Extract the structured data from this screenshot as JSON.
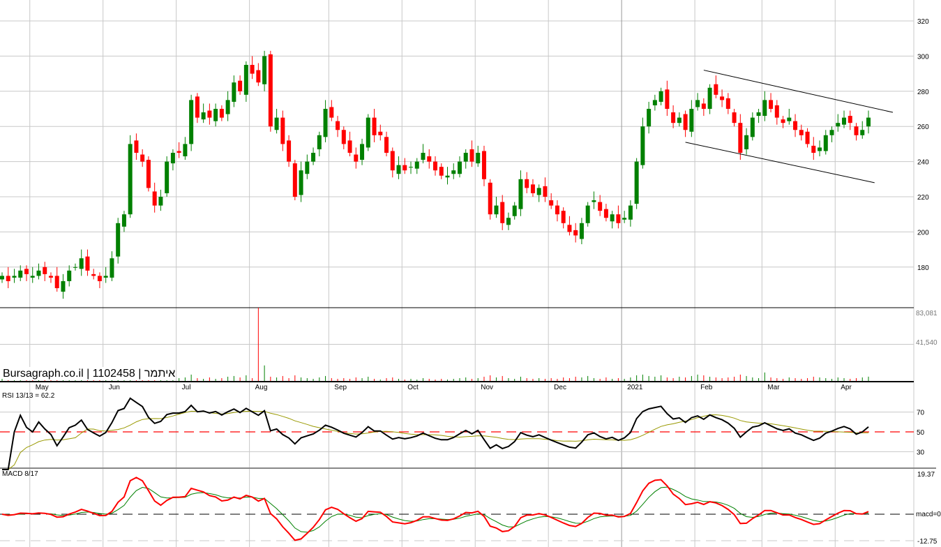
{
  "watermark": "Bursagraph.co.il | 1102458 | איתמר",
  "rsi_label": "RSI 13/13 = 62.2",
  "macd_label": "MACD 8/17",
  "chart_data": {
    "type": "candlestick",
    "price_axis": {
      "ticks": [
        180,
        200,
        220,
        240,
        260,
        280,
        300,
        320
      ],
      "range": [
        164,
        332
      ]
    },
    "volume_axis": {
      "ticks": [
        "83,081",
        "41,540"
      ],
      "max": 83081
    },
    "rsi_axis": {
      "ticks": [
        70,
        50,
        30
      ],
      "ref": 50
    },
    "macd_axis": {
      "ticks": [
        "19.37",
        "macd=0",
        "-12.75"
      ],
      "max": 19.37,
      "min": -12.75
    },
    "months": [
      {
        "label": "May",
        "i": 5
      },
      {
        "label": "Jun",
        "i": 17
      },
      {
        "label": "Jul",
        "i": 29
      },
      {
        "label": "Aug",
        "i": 41
      },
      {
        "label": "Sep",
        "i": 54
      },
      {
        "label": "Oct",
        "i": 66
      },
      {
        "label": "Nov",
        "i": 78
      },
      {
        "label": "Dec",
        "i": 90
      },
      {
        "label": "2021",
        "i": 102
      },
      {
        "label": "Feb",
        "i": 114
      },
      {
        "label": "Mar",
        "i": 125
      },
      {
        "label": "Apr",
        "i": 137
      }
    ],
    "closes": [
      175,
      172,
      175,
      178,
      176,
      175,
      178,
      176,
      174,
      168,
      172,
      178,
      180,
      185,
      178,
      175,
      172,
      175,
      185,
      205,
      210,
      250,
      245,
      240,
      225,
      215,
      220,
      240,
      245,
      245,
      250,
      275,
      265,
      268,
      265,
      270,
      265,
      275,
      285,
      280,
      295,
      290,
      285,
      300,
      260,
      265,
      250,
      240,
      220,
      235,
      240,
      245,
      255,
      270,
      265,
      258,
      250,
      245,
      240,
      250,
      265,
      255,
      255,
      245,
      235,
      238,
      235,
      237,
      240,
      245,
      240,
      235,
      232,
      232,
      235,
      240,
      245,
      240,
      245,
      230,
      210,
      215,
      205,
      208,
      215,
      230,
      225,
      222,
      225,
      220,
      215,
      210,
      205,
      200,
      198,
      205,
      215,
      218,
      212,
      208,
      210,
      205,
      208,
      215,
      240,
      260,
      270,
      275,
      280,
      270,
      262,
      265,
      258,
      270,
      275,
      270,
      282,
      278,
      275,
      270,
      262,
      245,
      255,
      265,
      268,
      275,
      270,
      265,
      262,
      265,
      258,
      255,
      250,
      245,
      248,
      255,
      258,
      262,
      265,
      262,
      255,
      258,
      265
    ],
    "volumes": [
      3,
      2,
      4,
      3,
      2,
      3,
      2,
      4,
      3,
      5,
      2,
      3,
      4,
      5,
      3,
      2,
      3,
      4,
      6,
      9,
      8,
      12,
      7,
      6,
      5,
      4,
      3,
      6,
      5,
      4,
      5,
      9,
      4,
      3,
      5,
      3,
      4,
      6,
      7,
      5,
      8,
      4,
      83081,
      22,
      6,
      5,
      7,
      4,
      8,
      5,
      4,
      3,
      5,
      7,
      4,
      3,
      4,
      3,
      5,
      4,
      6,
      3,
      2,
      4,
      5,
      3,
      2,
      3,
      2,
      4,
      3,
      2,
      3,
      2,
      3,
      4,
      5,
      3,
      4,
      6,
      8,
      5,
      7,
      4,
      3,
      6,
      4,
      3,
      4,
      3,
      4,
      3,
      5,
      4,
      6,
      5,
      7,
      4,
      3,
      5,
      3,
      4,
      3,
      5,
      8,
      9,
      7,
      6,
      8,
      5,
      4,
      6,
      5,
      7,
      9,
      8,
      6,
      5,
      4,
      5,
      6,
      9,
      7,
      5,
      4,
      12,
      5,
      4,
      3,
      5,
      4,
      3,
      4,
      6,
      5,
      4,
      3,
      5,
      4,
      3,
      4,
      5,
      6
    ],
    "trendlines": [
      {
        "name": "upper-channel",
        "from": {
          "i": 115,
          "price": 292
        },
        "to": {
          "i": 146,
          "price": 268
        }
      },
      {
        "name": "lower-channel",
        "from": {
          "i": 112,
          "price": 251
        },
        "to": {
          "i": 143,
          "price": 228
        }
      }
    ],
    "colors": {
      "up": "#008000",
      "down": "#ff0000",
      "rsi": "#000000",
      "signal": "#999900",
      "macd": "#ff0000",
      "macd_signal": "#008000"
    }
  }
}
